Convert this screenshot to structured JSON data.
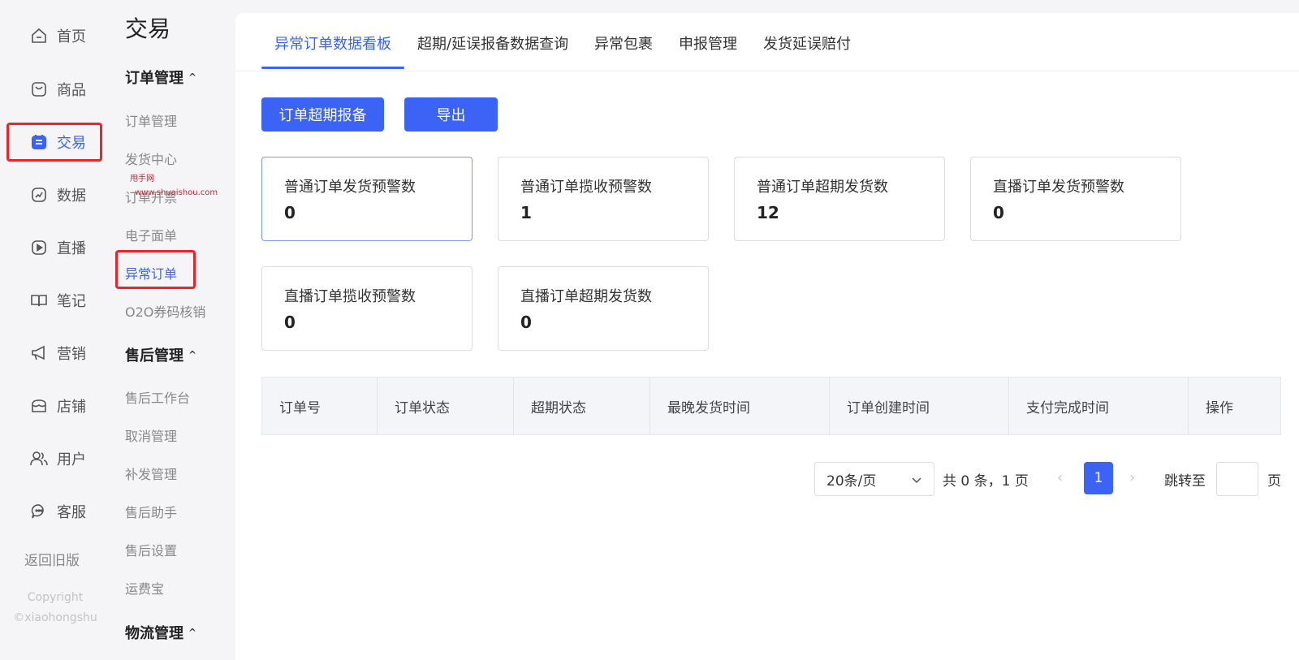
{
  "rail": {
    "items": [
      {
        "label": "首页",
        "icon": "home-icon"
      },
      {
        "label": "商品",
        "icon": "bag-icon"
      },
      {
        "label": "交易",
        "icon": "trade-icon",
        "active": true
      },
      {
        "label": "数据",
        "icon": "chart-icon"
      },
      {
        "label": "直播",
        "icon": "play-icon"
      },
      {
        "label": "笔记",
        "icon": "book-icon"
      },
      {
        "label": "营销",
        "icon": "megaphone-icon"
      },
      {
        "label": "店铺",
        "icon": "store-icon"
      },
      {
        "label": "用户",
        "icon": "users-icon"
      },
      {
        "label": "客服",
        "icon": "chat-icon"
      }
    ],
    "legacy": "返回旧版",
    "copyright_1": "Copyright",
    "copyright_2": "©xiaohongshu"
  },
  "submenu": {
    "title": "交易",
    "groups": [
      {
        "label": "订单管理",
        "items": [
          "订单管理",
          "发货中心",
          "订单开票",
          "电子面单",
          "异常订单",
          "O2O券码核销"
        ]
      },
      {
        "label": "售后管理",
        "items": [
          "售后工作台",
          "取消管理",
          "补发管理",
          "售后助手",
          "售后设置",
          "运费宝"
        ]
      },
      {
        "label": "物流管理"
      }
    ],
    "active_item": "异常订单",
    "watermark_1": "甩手网",
    "watermark_2": "www.shuaishou.com"
  },
  "tabs": [
    "异常订单数据看板",
    "超期/延误报备数据查询",
    "异常包裹",
    "申报管理",
    "发货延误赔付"
  ],
  "buttons": {
    "report": "订单超期报备",
    "export": "导出"
  },
  "cards": [
    {
      "title": "普通订单发货预警数",
      "value": "0"
    },
    {
      "title": "普通订单揽收预警数",
      "value": "1"
    },
    {
      "title": "普通订单超期发货数",
      "value": "12"
    },
    {
      "title": "直播订单发货预警数",
      "value": "0"
    },
    {
      "title": "直播订单揽收预警数",
      "value": "0"
    },
    {
      "title": "直播订单超期发货数",
      "value": "0"
    }
  ],
  "table": {
    "columns": [
      "订单号",
      "订单状态",
      "超期状态",
      "最晚发货时间",
      "订单创建时间",
      "支付完成时间",
      "操作"
    ]
  },
  "pagination": {
    "page_size": "20条/页",
    "total": "共 0 条，1 页",
    "current_page": "1",
    "jump_label": "跳转至",
    "jump_unit": "页",
    "prev": "‹",
    "next": "›"
  },
  "colors": {
    "accent": "#3b63f5",
    "highlight_box": "#e8262a"
  }
}
